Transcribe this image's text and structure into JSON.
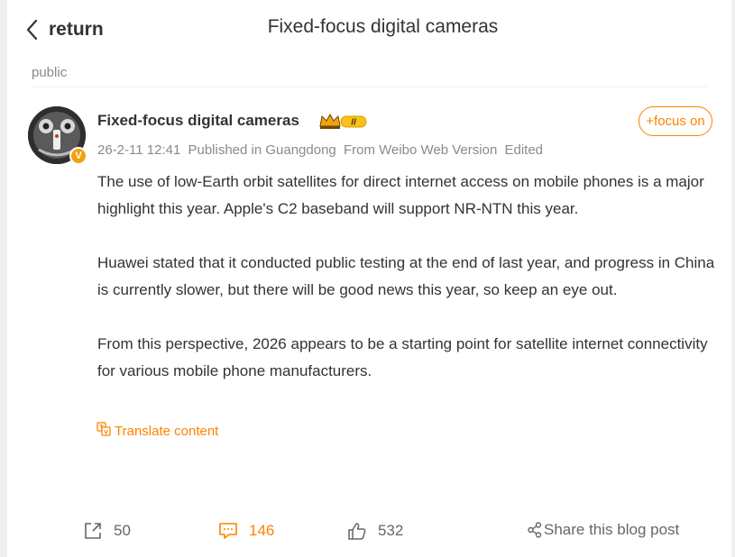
{
  "header": {
    "back_label": "return",
    "title": "Fixed-focus digital cameras"
  },
  "visibility": "public",
  "post": {
    "author": "Fixed-focus digital cameras",
    "author_level": "II",
    "verified_mark": "V",
    "follow_label": "+focus on",
    "date": "26-2-11 12:41",
    "location": "Published in Guangdong",
    "source": "From Weibo Web Version",
    "edited": "Edited",
    "paragraphs": [
      "The use of low-Earth orbit satellites for direct internet access on mobile phones is a major highlight this year. Apple's C2 baseband will support NR-NTN this year.",
      "Huawei stated that it conducted public testing at the end of last year, and progress in China is currently slower, but there will be good news this year, so keep an eye out.",
      "From this perspective, 2026 appears to be a starting point for satellite internet connectivity for various mobile phone manufacturers."
    ],
    "translate_label": "Translate content"
  },
  "actions": {
    "forward_count": "50",
    "comment_count": "146",
    "like_count": "532",
    "share_label": "Share this blog post"
  },
  "colors": {
    "accent": "#ff8200",
    "text": "#333333",
    "muted": "#8a8a8a",
    "badge": "#f3a10d"
  }
}
